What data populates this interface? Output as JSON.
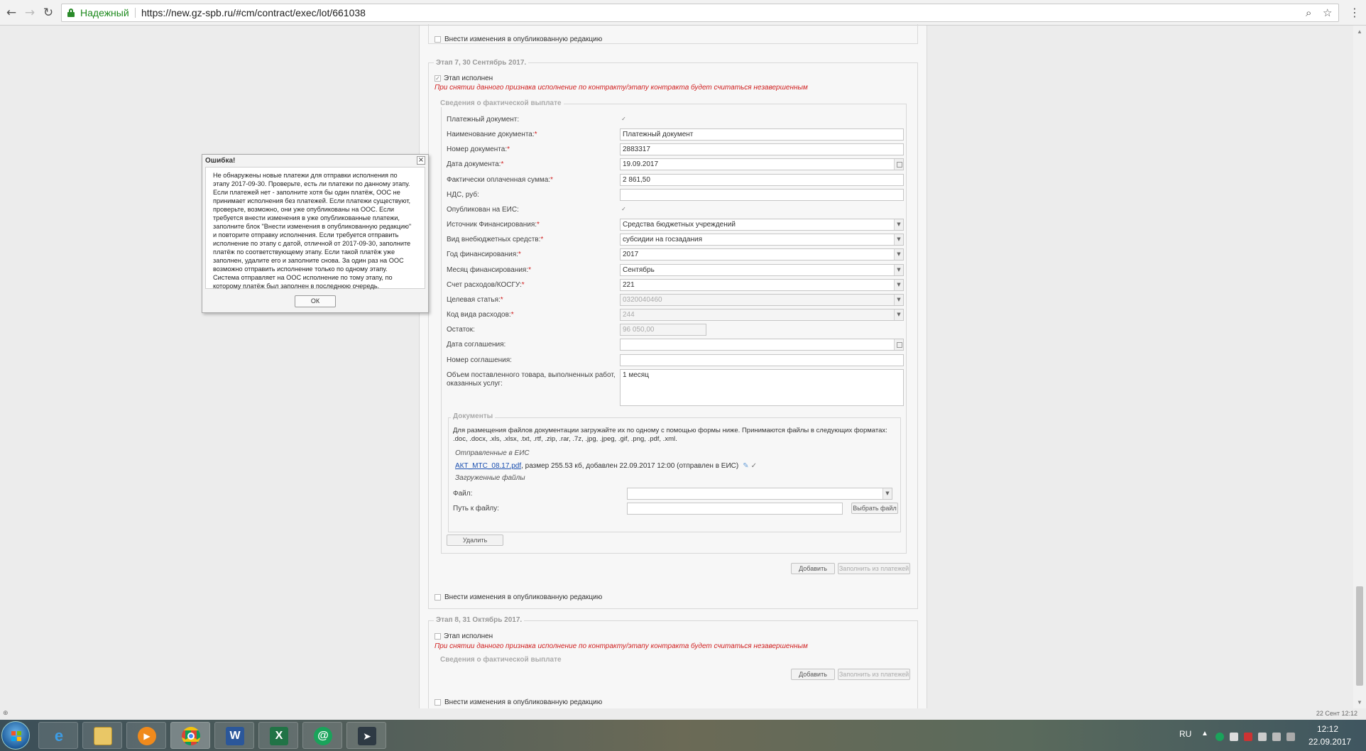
{
  "browser": {
    "secure_label": "Надежный",
    "url": "https://new.gz-spb.ru/#cm/contract/exec/lot/661038"
  },
  "top": {
    "edit_published_label": "Внести изменения в опубликованную редакцию"
  },
  "stage7": {
    "title": "Этап 7, 30 Сентябрь 2017.",
    "executed_label": "Этап исполнен",
    "executed_checked": true,
    "warning": "При снятии данного признака исполнение по контракту/этапу контракта будет считаться незавершенным",
    "payment_section_title": "Сведения о фактической выплате",
    "fields": {
      "payment_doc_label": "Платежный документ:",
      "doc_name_label": "Наименование документа:",
      "doc_name_value": "Платежный документ",
      "doc_number_label": "Номер документа:",
      "doc_number_value": "2883317",
      "doc_date_label": "Дата документа:",
      "doc_date_value": "19.09.2017",
      "paid_sum_label": "Фактически оплаченная сумма:",
      "paid_sum_value": "2 861,50",
      "vat_label": "НДС, руб:",
      "vat_value": "",
      "published_eis_label": "Опубликован на ЕИС:",
      "funding_source_label": "Источник Финансирования:",
      "funding_source_value": "Средства бюджетных учреждений",
      "offbudget_type_label": "Вид внебюджетных средств:",
      "offbudget_type_value": "субсидии на госзадания",
      "funding_year_label": "Год финансирования:",
      "funding_year_value": "2017",
      "funding_month_label": "Месяц финансирования:",
      "funding_month_value": "Сентябрь",
      "expense_account_label": "Счет расходов/КОСГУ:",
      "expense_account_value": "221",
      "target_article_label": "Целевая статья:",
      "target_article_value": "0320040460",
      "expense_type_label": "Код вида расходов:",
      "expense_type_value": "244",
      "remainder_label": "Остаток:",
      "remainder_value": "96 050,00",
      "agreement_date_label": "Дата соглашения:",
      "agreement_number_label": "Номер соглашения:",
      "volume_label_1": "Объем поставленного товара, выполненных работ,",
      "volume_label_2": "оказанных услуг:",
      "volume_value": "1 месяц"
    },
    "documents": {
      "title": "Документы",
      "hint_1": "Для размещения файлов документации загружайте их по одному с помощью формы ниже. Принимаются файлы в следующих форматах:",
      "hint_2": ".doc, .docx, .xls, .xlsx, .txt, .rtf, .zip, .rar, .7z, .jpg, .jpeg, .gif, .png, .pdf, .xml.",
      "sent_label": "Отправленные в ЕИС",
      "file_link": "АКТ_МТС_08.17.pdf",
      "file_meta": ", размер 255.53 кб, добавлен 22.09.2017 12:00 (отправлен в ЕИС)",
      "uploaded_label": "Загруженные файлы",
      "file_label": "Файл:",
      "path_label": "Путь к файлу:",
      "choose_file_button": "Выбрать файл",
      "delete_button": "Удалить"
    },
    "add_button": "Добавить",
    "fill_from_payments_button": "Заполнить из платежей",
    "edit_published_label": "Внести изменения в опубликованную редакцию"
  },
  "stage8": {
    "title": "Этап 8, 31 Октябрь 2017.",
    "executed_label": "Этап исполнен",
    "executed_checked": false,
    "warning": "При снятии данного признака исполнение по контракту/этапу контракта будет считаться незавершенным",
    "payment_section_title": "Сведения о фактической выплате",
    "add_button": "Добавить",
    "fill_from_payments_button": "Заполнить из платежей",
    "edit_published_label": "Внести изменения в опубликованную редакцию"
  },
  "dialog": {
    "title": "Ошибка!",
    "lines": [
      "Не обнаружены новые платежи для отправки исполнения по",
      "этапу 2017-09-30. Проверьте, есть ли платежи по данному этапу.",
      "Если платежей нет - заполните хотя бы один платёж, ООС не",
      "принимает исполнения без платежей. Если платежи существуют,",
      "проверьте, возможно, они уже опубликованы на ООС. Если",
      "требуется внести изменения в уже опубликованные платежи,",
      "заполните блок \"Внести изменения в опубликованную редакцию\"",
      "и повторите отправку исполнения. Если требуется отправить",
      "исполнение по этапу с датой, отличной от 2017-09-30, заполните",
      "платёж по соответствующему этапу. Если такой платёж уже",
      "заполнен, удалите его и заполните снова. За один раз на ООС",
      "возможно отправить исполнение только по одному этапу.",
      "Система отправляет на ООС исполнение по тому этапу, по",
      "которому платёж был заполнен в последнюю очередь."
    ],
    "ok_button": "ОК"
  },
  "status": {
    "right_text": "22 Сент 12:12"
  },
  "taskbar": {
    "language": "RU",
    "time": "12:12",
    "date": "22.09.2017"
  },
  "colors": {
    "warning_red": "#d02020",
    "link_blue": "#1a4fb0",
    "secure_green": "#1d8a1d"
  }
}
